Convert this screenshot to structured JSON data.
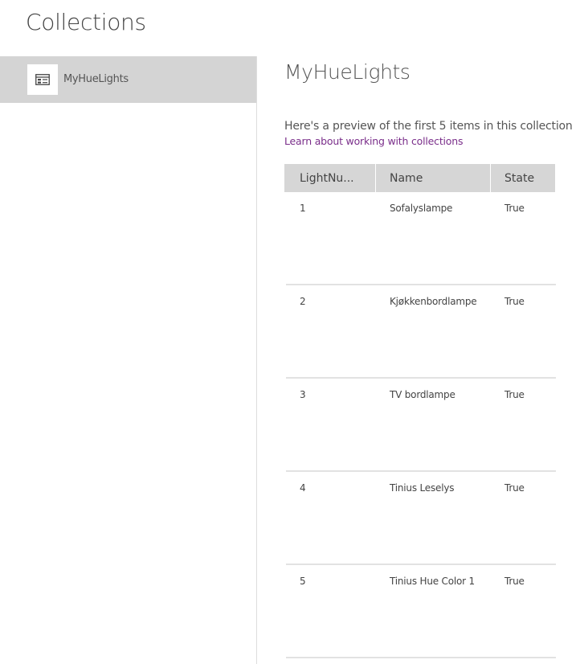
{
  "page": {
    "title": "Collections"
  },
  "sidebar": {
    "items": [
      {
        "label": "MyHueLights",
        "icon": "collection-icon",
        "selected": true
      }
    ]
  },
  "main": {
    "title": "MyHueLights",
    "preview_text": "Here's a preview of the first 5 items in this collection",
    "learn_link": "Learn about working with collections",
    "table": {
      "columns": [
        "LightNu...",
        "Name",
        "State"
      ],
      "rows": [
        {
          "lightnumber": "1",
          "name": "Sofalyslampe",
          "state": "True"
        },
        {
          "lightnumber": "2",
          "name": "Kjøkkenbordlampe",
          "state": "True"
        },
        {
          "lightnumber": "3",
          "name": "TV bordlampe",
          "state": "True"
        },
        {
          "lightnumber": "4",
          "name": "Tinius Leselys",
          "state": "True"
        },
        {
          "lightnumber": "5",
          "name": "Tinius Hue Color 1",
          "state": "True"
        }
      ]
    }
  },
  "colors": {
    "sidebar_selected_bg": "#d4d4d4",
    "table_header_bg": "#d6d6d6",
    "link": "#7a2e8a"
  }
}
